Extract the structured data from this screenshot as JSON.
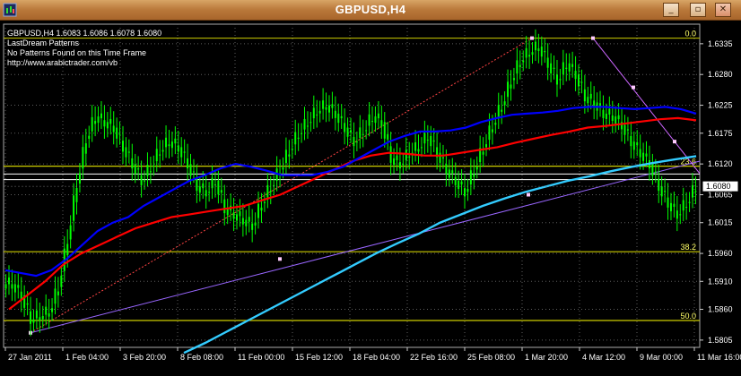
{
  "window": {
    "title": "GBPUSD,H4",
    "buttons": {
      "minimize": "_",
      "restore": "▫",
      "close": "✕"
    }
  },
  "info": {
    "line1": "GBPUSD,H4  1.6083 1.6086 1.6078 1.6080",
    "line2": "LastDream Patterns",
    "line3": "No Patterns Found on this Time Frame",
    "line4": "http://www.arabictrader.com/vb"
  },
  "colors": {
    "background": "#000000",
    "candles": "#00ff00",
    "grid": "#5e5e5e",
    "ma_blue": "#0000ff",
    "ma_red": "#ff0000",
    "ma_cyan": "#33ccff",
    "fib_level": "#cccc00",
    "fib_text": "#ffff66",
    "trendline": "#9966ff",
    "zigzag": "#cc66ff",
    "price_tag_bg": "#ffffff"
  },
  "chart_data": {
    "type": "candlestick",
    "symbol": "GBPUSD",
    "timeframe": "H4",
    "ohlc_current": {
      "open": 1.6083,
      "high": 1.6086,
      "low": 1.6078,
      "close": 1.608
    },
    "current_price": "1.6080",
    "y_ticks": [
      "1.6335",
      "1.6280",
      "1.6225",
      "1.6175",
      "1.6120",
      "1.6065",
      "1.6015",
      "1.5960",
      "1.5910",
      "1.5860",
      "1.5805"
    ],
    "y_tick_values": [
      1.6335,
      1.628,
      1.6225,
      1.6175,
      1.612,
      1.6065,
      1.6015,
      1.596,
      1.591,
      1.586,
      1.5805
    ],
    "ylim": [
      1.5792,
      1.637
    ],
    "x_ticks": [
      "27 Jan 2011",
      "1 Feb 04:00",
      "3 Feb 20:00",
      "8 Feb 08:00",
      "11 Feb 00:00",
      "15 Feb 12:00",
      "18 Feb 04:00",
      "22 Feb 16:00",
      "25 Feb 08:00",
      "1 Mar 20:00",
      "4 Mar 12:00",
      "9 Mar 00:00",
      "11 Mar 16:00"
    ],
    "fib_levels": [
      {
        "label": "0.0",
        "price": 1.6345
      },
      {
        "label": "23.6",
        "price": 1.6116
      },
      {
        "label": "38.2",
        "price": 1.5963
      },
      {
        "label": "50.0",
        "price": 1.584
      }
    ],
    "close_series": [
      1.5905,
      1.5885,
      1.5842,
      1.5848,
      1.5855,
      1.59,
      1.5985,
      1.6085,
      1.6165,
      1.6205,
      1.6195,
      1.6185,
      1.615,
      1.612,
      1.609,
      1.6115,
      1.6145,
      1.616,
      1.615,
      1.612,
      1.608,
      1.607,
      1.609,
      1.604,
      1.603,
      1.602,
      1.601,
      1.605,
      1.608,
      1.611,
      1.6145,
      1.6175,
      1.6195,
      1.6215,
      1.6225,
      1.621,
      1.6185,
      1.616,
      1.618,
      1.6205,
      1.6195,
      1.613,
      1.612,
      1.614,
      1.615,
      1.617,
      1.614,
      1.611,
      1.609,
      1.607,
      1.611,
      1.615,
      1.619,
      1.6225,
      1.627,
      1.6305,
      1.632,
      1.633,
      1.63,
      1.627,
      1.63,
      1.628,
      1.624,
      1.623,
      1.621,
      1.6205,
      1.619,
      1.616,
      1.614,
      1.612,
      1.608,
      1.605,
      1.603,
      1.605,
      1.608
    ],
    "ma_blue": [
      1.593,
      1.5925,
      1.592,
      1.593,
      1.595,
      1.5975,
      1.6,
      1.6015,
      1.6025,
      1.6045,
      1.606,
      1.6075,
      1.609,
      1.61,
      1.6112,
      1.612,
      1.6115,
      1.6108,
      1.61,
      1.61,
      1.61,
      1.6106,
      1.6115,
      1.613,
      1.6145,
      1.616,
      1.617,
      1.6178,
      1.6178,
      1.618,
      1.6185,
      1.6195,
      1.6202,
      1.6208,
      1.621,
      1.6212,
      1.6215,
      1.622,
      1.6222,
      1.6222,
      1.622,
      1.6218,
      1.622,
      1.6222,
      1.6218,
      1.621
    ],
    "ma_red": [
      1.586,
      1.5885,
      1.591,
      1.594,
      1.596,
      1.5975,
      1.599,
      1.6005,
      1.6015,
      1.6025,
      1.603,
      1.6035,
      1.604,
      1.6045,
      1.6055,
      1.6065,
      1.608,
      1.6095,
      1.611,
      1.6125,
      1.6135,
      1.614,
      1.6138,
      1.6135,
      1.6135,
      1.614,
      1.6145,
      1.615,
      1.6158,
      1.6165,
      1.6172,
      1.6178,
      1.6185,
      1.6188,
      1.6192,
      1.6196,
      1.62,
      1.6202,
      1.6198
    ],
    "ma_cyan": [
      1.5782,
      1.58,
      1.582,
      1.584,
      1.586,
      1.588,
      1.59,
      1.592,
      1.594,
      1.596,
      1.5978,
      1.5995,
      1.6015,
      1.603,
      1.6045,
      1.6058,
      1.607,
      1.608,
      1.609,
      1.6098,
      1.6107,
      1.6115,
      1.6122,
      1.6128,
      1.6134
    ]
  }
}
